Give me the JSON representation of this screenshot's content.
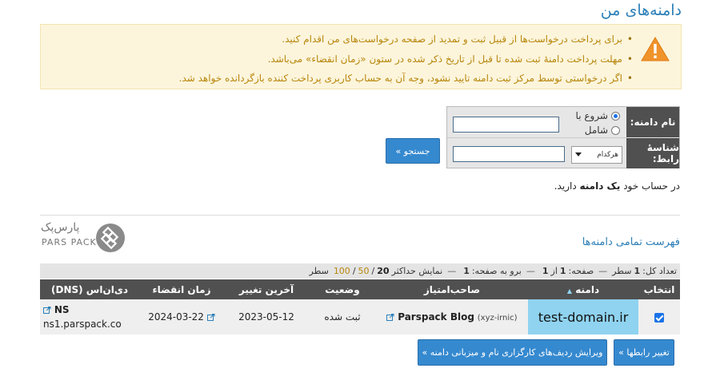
{
  "page_title": "دامنه‌های من",
  "notices": [
    "برای پرداخت درخواست‌ها از قبیل ثبت و تمدید از صفحه درخواست‌های من اقدام کنید.",
    "مهلت پرداخت دامنهٔ ثبت شده تا قبل از تاریخ ذکر شده در ستون «زمان انقضاء» می‌باشد.",
    "اگر درخواستی توسط مرکز ثبت دامنه تایید نشود، وجه آن به حساب کاربری پرداخت کننده بازگردانده خواهد شد."
  ],
  "search": {
    "domain_label": "نام دامنه:",
    "reseller_label": "شناسهٔ رابط:",
    "opt_starts": "شروع با",
    "opt_contains": "شامل",
    "domain_value": "",
    "reseller_value": "",
    "select_value": "هرکدام",
    "search_button": "جستجو »"
  },
  "account": {
    "prefix": "در حساب خود",
    "count": "یک دامنه",
    "suffix": "دارید."
  },
  "logo": {
    "fa": "پارس‌پک",
    "en": "PARS PACK"
  },
  "list_title": "فهرست تمامی دامنه‌ها",
  "stats": {
    "total_label": "تعداد کل:",
    "total_value": "1",
    "total_unit": "سطر",
    "page_label": "صفحه:",
    "page_value": "1",
    "page_of": "از",
    "page_total": "1",
    "goto_label": "برو به صفحه:",
    "goto_value": "1",
    "show_label": "نمایش حداکثر",
    "show_opt1": "20",
    "show_opt2": "50",
    "show_opt3": "100",
    "show_sep": "/",
    "show_unit": "سطر"
  },
  "table": {
    "headers": {
      "select": "انتخاب",
      "domain": "دامنه",
      "owner": "صاحب‌امتیاز",
      "status": "وضعیت",
      "last_change": "آخرین تغییر",
      "expiry": "زمان انقضاء",
      "dns": "دی‌ان‌اس (DNS)"
    },
    "row": {
      "domain": "test-domain.ir",
      "owner_name": "Parspack Blog",
      "owner_id": "(xyz-irnic)",
      "status": "ثبت شده",
      "last_change": "2023-05-12",
      "expiry": "2024-03-22",
      "dns_label": "NS",
      "dns_value": "ns1.parspack.co"
    }
  },
  "buttons": {
    "change_links": "تغییر رابطها »",
    "edit_dns": "ویرایش ردیف‌های کارگزاری نام و میزبانی دامنه »"
  },
  "colors": {
    "accent": "#2c7fb8",
    "button": "#3589cf",
    "notice_bg": "#fcf5dc",
    "notice_text": "#b8860b",
    "header_bg": "#505050",
    "domain_cell": "#8fd3f0"
  }
}
